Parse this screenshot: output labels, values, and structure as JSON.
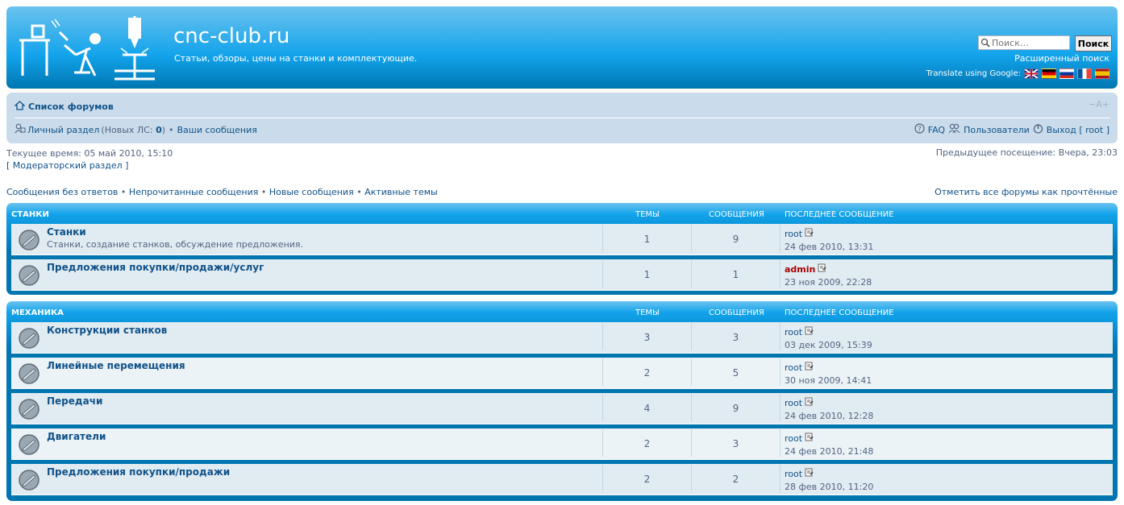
{
  "header": {
    "site_title": "cnc-club.ru",
    "site_description": "Статьи, обзоры, цены на станки и комплектующие.",
    "search_placeholder": "Поиск…",
    "search_button": "Поиск",
    "advanced_search": "Расширенный поиск",
    "translate_label": "Translate using Google:",
    "flags": [
      "english-flag",
      "german-flag",
      "russian-flag",
      "french-flag",
      "spanish-flag"
    ]
  },
  "navbar": {
    "breadcrumb": "Список форумов",
    "font_size_control": "−A+",
    "ucp_label": "Личный раздел",
    "pm_prefix": "(Новых ЛС:",
    "pm_count": "0",
    "pm_suffix": ")",
    "bullet": "•",
    "your_posts": "Ваши сообщения",
    "faq": "FAQ",
    "members": "Пользователи",
    "logout": "Выход",
    "logout_user": "[ root ]"
  },
  "info": {
    "current_time": "Текущее время: 05 май 2010, 15:10",
    "mcp_link": "[ Модераторский раздел ]",
    "last_visit": "Предыдущее посещение: Вчера, 23:03"
  },
  "quick_links": {
    "unanswered": "Сообщения без ответов",
    "unread": "Непрочитанные сообщения",
    "new_posts": "Новые сообщения",
    "active": "Активные темы",
    "mark_all_read": "Отметить все форумы как прочтённые"
  },
  "columns": {
    "topics": "ТЕМЫ",
    "posts": "СООБЩЕНИЯ",
    "last_post": "ПОСЛЕДНЕЕ СООБЩЕНИЕ"
  },
  "categories": [
    {
      "name": "СТАНКИ",
      "forums": [
        {
          "title": "Станки",
          "desc": "Станки, создание станков, обсуждение предложения.",
          "topics": "1",
          "posts": "9",
          "last_user": "root",
          "last_date": "24 фев 2010, 13:31"
        },
        {
          "title": "Предложения покупки/продажи/услуг",
          "desc": "",
          "topics": "1",
          "posts": "1",
          "last_user": "admin",
          "last_date": "23 ноя 2009, 22:28"
        }
      ]
    },
    {
      "name": "МЕХАНИКА",
      "forums": [
        {
          "title": "Конструкции станков",
          "desc": "",
          "topics": "3",
          "posts": "3",
          "last_user": "root",
          "last_date": "03 дек 2009, 15:39"
        },
        {
          "title": "Линейные перемещения",
          "desc": "",
          "topics": "2",
          "posts": "5",
          "last_user": "root",
          "last_date": "30 ноя 2009, 14:41"
        },
        {
          "title": "Передачи",
          "desc": "",
          "topics": "4",
          "posts": "9",
          "last_user": "root",
          "last_date": "24 фев 2010, 12:28"
        },
        {
          "title": "Двигатели",
          "desc": "",
          "topics": "2",
          "posts": "3",
          "last_user": "root",
          "last_date": "24 фев 2010, 21:48"
        },
        {
          "title": "Предложения покупки/продажи",
          "desc": "",
          "topics": "2",
          "posts": "2",
          "last_user": "root",
          "last_date": "28 фев 2010, 11:20"
        }
      ]
    }
  ],
  "colors": {
    "header_blue": "#12a3eb",
    "nav_bg": "#cadceb",
    "link": "#105289",
    "admin": "#aa0000"
  }
}
